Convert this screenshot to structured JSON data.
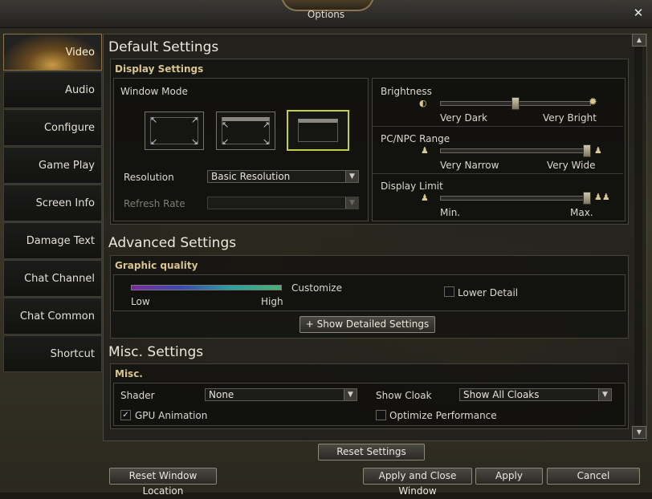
{
  "window": {
    "title": "Options",
    "close_label": "✕"
  },
  "sidebar": {
    "items": [
      {
        "label": "Video",
        "active": true
      },
      {
        "label": "Audio"
      },
      {
        "label": "Configure"
      },
      {
        "label": "Game Play"
      },
      {
        "label": "Screen Info"
      },
      {
        "label": "Damage Text"
      },
      {
        "label": "Chat Channel"
      },
      {
        "label": "Chat Common"
      },
      {
        "label": "Shortcut"
      }
    ]
  },
  "default_settings": {
    "heading": "Default Settings",
    "display": {
      "title": "Display Settings",
      "window_mode_label": "Window Mode",
      "window_modes": [
        "fullscreen",
        "window-titled",
        "window-borderless"
      ],
      "selected_mode": 2,
      "resolution_label": "Resolution",
      "resolution_value": "Basic Resolution",
      "refresh_label": "Refresh Rate",
      "refresh_value": ""
    },
    "brightness": {
      "label": "Brightness",
      "min_label": "Very Dark",
      "max_label": "Very Bright",
      "value": 0.5
    },
    "pc_npc_range": {
      "label": "PC/NPC Range",
      "min_label": "Very Narrow",
      "max_label": "Very Wide",
      "value": 1.0
    },
    "display_limit": {
      "label": "Display Limit",
      "min_label": "Min.",
      "max_label": "Max.",
      "value": 1.0
    }
  },
  "advanced_settings": {
    "heading": "Advanced Settings",
    "graphic_quality": {
      "title": "Graphic quality",
      "low_label": "Low",
      "high_label": "High",
      "current_label": "Customize",
      "lower_detail_label": "Lower Detail",
      "lower_detail_checked": false
    },
    "show_detailed_button": "+  Show Detailed Settings"
  },
  "misc_settings": {
    "heading": "Misc. Settings",
    "title": "Misc.",
    "shader_label": "Shader",
    "shader_value": "None",
    "show_cloak_label": "Show Cloak",
    "show_cloak_value": "Show All Cloaks",
    "gpu_animation_label": "GPU Animation",
    "gpu_animation_checked": true,
    "optimize_label": "Optimize Performance",
    "optimize_checked": false
  },
  "buttons": {
    "reset_settings": "Reset Settings",
    "reset_window_location": "Reset Window Location",
    "apply_and_close": "Apply and Close Window",
    "apply": "Apply",
    "cancel": "Cancel"
  },
  "icons": {
    "dropdown": "▼",
    "scroll_up": "▲",
    "scroll_down": "▼",
    "check": "✓"
  },
  "colors": {
    "accent": "#c2d040",
    "gold": "#d8c48e",
    "active_tab": "#c79a45"
  }
}
